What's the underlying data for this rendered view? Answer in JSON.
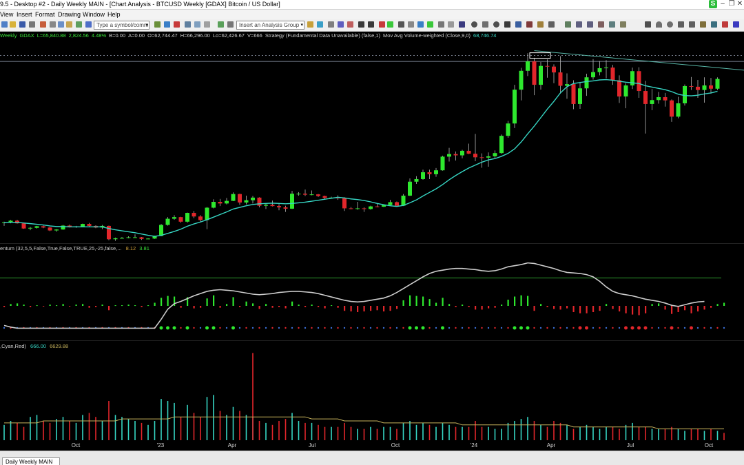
{
  "window": {
    "title": "9.5 - Desktop #2 - Daily Weekly MAIN - [Chart Analysis - BTCUSD Weekly [GDAX] Bitcoin / US Dollar]",
    "badge": "S"
  },
  "menu": [
    "View",
    "Insert",
    "Format",
    "Drawing",
    "Window",
    "Help"
  ],
  "toolbar": {
    "symbol_placeholder": "Type a symbol/command",
    "analysis_group_placeholder": "Insert an Analysis Group"
  },
  "status_line": [
    {
      "text": "Weekly",
      "color": "#39e339"
    },
    {
      "text": "GDAX",
      "color": "#39e339"
    },
    {
      "text": "L=65,840.88",
      "color": "#39e339"
    },
    {
      "text": "2,824.56",
      "color": "#39e339"
    },
    {
      "text": "4.48%",
      "color": "#39e339"
    },
    {
      "text": "B=0.00",
      "color": "#d0d0d0"
    },
    {
      "text": "A=0.00",
      "color": "#d0d0d0"
    },
    {
      "text": "O=62,744.47",
      "color": "#d0d0d0"
    },
    {
      "text": "H=66,296.00",
      "color": "#d0d0d0"
    },
    {
      "text": "Lo=62,426.67",
      "color": "#d0d0d0"
    },
    {
      "text": "V=666",
      "color": "#d0d0d0"
    },
    {
      "text": "Strategy (Fundamental Data Unavailable) (false,1)",
      "color": "#d0d0d0"
    },
    {
      "text": "Mov Avg Volume-weighted (Close,9,0)",
      "color": "#d0d0d0"
    },
    {
      "text": "68,746.74",
      "color": "#36d6c4"
    }
  ],
  "momentum_label": {
    "name": "entum (32,5,5,False,True,False,TRUE,25,-25,false,...",
    "v1": "8.12",
    "v2": "3.81"
  },
  "volume_label": {
    "name": ",Cyan,Red)",
    "v1": "666.00",
    "v2": "6629.88"
  },
  "x_axis_labels": [
    "Oct",
    "'23",
    "Apr",
    "Jul",
    "Oct",
    "'24",
    "Apr",
    "Jul",
    "Oct"
  ],
  "tabs": [
    {
      "label": "Daily Weekly MAIN"
    }
  ],
  "colors": {
    "up": "#2ee82e",
    "down": "#e2262b",
    "ma": "#36d6c4",
    "momentum_line": "#cccccc",
    "volume_ma": "#c7b35c"
  },
  "chart_data": [
    {
      "type": "candlestick",
      "symbol": "BTCUSD",
      "interval": "Weekly",
      "exchange": "GDAX",
      "ohlc": [
        [
          21500,
          21900,
          20600,
          21700
        ],
        [
          21700,
          22400,
          21400,
          22200
        ],
        [
          22200,
          22500,
          21300,
          21400
        ],
        [
          21400,
          21600,
          19700,
          19800
        ],
        [
          19800,
          20300,
          19300,
          20000
        ],
        [
          20000,
          20600,
          19800,
          20500
        ],
        [
          20500,
          20700,
          19900,
          20100
        ],
        [
          20100,
          20300,
          19000,
          19200
        ],
        [
          19200,
          19600,
          18800,
          19500
        ],
        [
          19500,
          20900,
          19400,
          20700
        ],
        [
          20700,
          21000,
          20100,
          20200
        ],
        [
          20200,
          20600,
          20000,
          20400
        ],
        [
          20400,
          21300,
          20300,
          21200
        ],
        [
          21200,
          21500,
          20400,
          20600
        ],
        [
          20600,
          20800,
          19900,
          20100
        ],
        [
          20100,
          20900,
          19600,
          20600
        ],
        [
          20600,
          20700,
          16200,
          16500
        ],
        [
          16500,
          17000,
          16000,
          16800
        ],
        [
          16800,
          17200,
          16700,
          16900
        ],
        [
          16900,
          17400,
          16800,
          17100
        ],
        [
          17100,
          18000,
          16900,
          17100
        ],
        [
          17100,
          17200,
          16300,
          16600
        ],
        [
          16600,
          16800,
          16500,
          16700
        ],
        [
          16700,
          17600,
          16600,
          17500
        ],
        [
          17500,
          21200,
          17400,
          20900
        ],
        [
          20900,
          23300,
          20700,
          22800
        ],
        [
          22800,
          23900,
          22500,
          23300
        ],
        [
          23300,
          23400,
          21600,
          21900
        ],
        [
          21900,
          24700,
          21600,
          24600
        ],
        [
          24600,
          25200,
          23000,
          23500
        ],
        [
          23500,
          23900,
          21800,
          22400
        ],
        [
          22400,
          26400,
          19600,
          26200
        ],
        [
          26200,
          28800,
          26000,
          28000
        ],
        [
          28000,
          28900,
          26700,
          27500
        ],
        [
          27500,
          29200,
          27200,
          28300
        ],
        [
          28300,
          30900,
          28200,
          30400
        ],
        [
          30400,
          30500,
          27100,
          27800
        ],
        [
          27800,
          29900,
          27200,
          28500
        ],
        [
          28500,
          29800,
          27500,
          29300
        ],
        [
          29300,
          29400,
          26300,
          26800
        ],
        [
          26800,
          27500,
          25800,
          27100
        ],
        [
          27100,
          28400,
          26600,
          26700
        ],
        [
          26700,
          27300,
          25400,
          26300
        ],
        [
          26300,
          26800,
          24900,
          25900
        ],
        [
          25900,
          31400,
          25800,
          30500
        ],
        [
          30500,
          31000,
          29900,
          30500
        ],
        [
          30500,
          31800,
          29800,
          30200
        ],
        [
          30200,
          31500,
          30000,
          30300
        ],
        [
          30300,
          30400,
          29500,
          29800
        ],
        [
          29800,
          29900,
          28900,
          29200
        ],
        [
          29200,
          29600,
          29000,
          29300
        ],
        [
          29300,
          30000,
          28600,
          29100
        ],
        [
          29100,
          29400,
          25200,
          26000
        ],
        [
          26000,
          26400,
          25700,
          25900
        ],
        [
          25900,
          28000,
          25600,
          26000
        ],
        [
          26000,
          26300,
          24900,
          25800
        ],
        [
          25800,
          26800,
          25600,
          26600
        ],
        [
          26600,
          27400,
          26300,
          26500
        ],
        [
          26500,
          27100,
          26400,
          27000
        ],
        [
          27000,
          28600,
          26900,
          27900
        ],
        [
          27900,
          28100,
          26900,
          26800
        ],
        [
          26800,
          30400,
          26700,
          29900
        ],
        [
          29900,
          35200,
          29800,
          34200
        ],
        [
          34200,
          35900,
          33500,
          35000
        ],
        [
          35000,
          37900,
          34800,
          37100
        ],
        [
          37100,
          37900,
          35000,
          36500
        ],
        [
          36500,
          38400,
          35700,
          37700
        ],
        [
          37700,
          42200,
          37600,
          41900
        ],
        [
          41900,
          44600,
          40400,
          42700
        ],
        [
          42700,
          43500,
          40700,
          42300
        ],
        [
          42300,
          44000,
          41400,
          43700
        ],
        [
          43700,
          45900,
          42700,
          42800
        ],
        [
          42800,
          48900,
          40500,
          41700
        ],
        [
          41700,
          42900,
          38500,
          41600
        ],
        [
          41600,
          43200,
          38800,
          42000
        ],
        [
          42000,
          43800,
          41500,
          43000
        ],
        [
          43000,
          48700,
          42800,
          48300
        ],
        [
          48300,
          52900,
          47700,
          52100
        ],
        [
          52100,
          64000,
          50700,
          62500
        ],
        [
          62500,
          69200,
          59200,
          68300
        ],
        [
          68300,
          73700,
          66700,
          71200
        ],
        [
          71200,
          72300,
          60800,
          64000
        ],
        [
          64000,
          71000,
          62500,
          69800
        ],
        [
          69800,
          71800,
          66200,
          69600
        ],
        [
          69600,
          70300,
          64500,
          67800
        ],
        [
          67800,
          72800,
          61300,
          63700
        ],
        [
          63700,
          67500,
          59700,
          64200
        ],
        [
          64200,
          65400,
          56500,
          58100
        ],
        [
          58100,
          64900,
          56600,
          62900
        ],
        [
          62900,
          67400,
          60600,
          66300
        ],
        [
          66300,
          71900,
          65600,
          67900
        ],
        [
          67900,
          71300,
          66900,
          69100
        ],
        [
          69100,
          71600,
          66000,
          69300
        ],
        [
          69300,
          70100,
          64000,
          65400
        ],
        [
          65400,
          66900,
          58400,
          60400
        ],
        [
          60400,
          64500,
          56800,
          63800
        ],
        [
          63800,
          69300,
          62700,
          68200
        ],
        [
          68200,
          69400,
          60000,
          62100
        ],
        [
          62100,
          65200,
          49000,
          58100
        ],
        [
          58100,
          62700,
          56200,
          59300
        ],
        [
          59300,
          61800,
          58200,
          60200
        ],
        [
          60200,
          61500,
          57300,
          59200
        ],
        [
          59200,
          59500,
          52600,
          54200
        ],
        [
          54200,
          60300,
          53700,
          58300
        ],
        [
          58300,
          64100,
          57600,
          63600
        ],
        [
          63600,
          66400,
          62400,
          63400
        ],
        [
          63400,
          65500,
          60000,
          62400
        ],
        [
          62400,
          66300,
          58500,
          63800
        ],
        [
          63800,
          66100,
          61300,
          62800
        ],
        [
          62800,
          66300,
          62400,
          65800
        ]
      ],
      "ma": [
        21600,
        21700,
        21700,
        21500,
        21300,
        21100,
        20900,
        20600,
        20400,
        20400,
        20300,
        20300,
        20300,
        20300,
        20300,
        20300,
        19800,
        19400,
        19100,
        18800,
        18500,
        18100,
        17700,
        17400,
        17700,
        18300,
        18900,
        19600,
        20500,
        21200,
        21800,
        22500,
        23300,
        24100,
        24900,
        25800,
        26300,
        26800,
        27200,
        27400,
        27500,
        27600,
        27500,
        27400,
        27500,
        27700,
        27900,
        28200,
        28500,
        28800,
        29100,
        29400,
        29200,
        28900,
        28700,
        28400,
        28000,
        27500,
        27100,
        26800,
        26600,
        26900,
        27700,
        28600,
        29800,
        30900,
        32000,
        33300,
        34800,
        36100,
        37300,
        38400,
        39300,
        40200,
        40900,
        41300,
        42000,
        42900,
        44300,
        46400,
        48900,
        51300,
        53900,
        56500,
        58900,
        61500,
        63400,
        64400,
        64700,
        65000,
        65200,
        65500,
        65600,
        65400,
        65100,
        64800,
        64600,
        64400,
        63700,
        63300,
        62900,
        62500,
        61900,
        61100,
        60700,
        60600,
        60800,
        61200,
        61500,
        62000
      ],
      "y_visible_range": [
        15500,
        78000
      ],
      "horizontal_lines": [
        73000,
        71200
      ],
      "trendline": {
        "start_index": 81,
        "start": 74500,
        "end_index": 112,
        "end": 68500
      }
    },
    {
      "type": "histogram",
      "name": "Momentum",
      "values": [
        -2,
        3,
        4,
        2,
        -2,
        1,
        -1,
        2,
        1,
        3,
        -1,
        2,
        3,
        -3,
        -2,
        2,
        -7,
        1,
        1,
        2,
        1,
        -2,
        1,
        5,
        13,
        16,
        15,
        -3,
        14,
        -4,
        -3,
        12,
        17,
        -3,
        3,
        14,
        -2,
        7,
        4,
        -5,
        3,
        -3,
        -2,
        -4,
        7,
        2,
        -2,
        2,
        -2,
        -4,
        1,
        -3,
        -8,
        -9,
        -10,
        -9,
        -8,
        -7,
        -9,
        -8,
        -5,
        9,
        17,
        16,
        15,
        11,
        5,
        13,
        3,
        -2,
        2,
        -2,
        -6,
        -6,
        -4,
        -3,
        2,
        10,
        15,
        17,
        16,
        -8,
        3,
        -2,
        -5,
        -6,
        -4,
        -10,
        -12,
        -12,
        -10,
        -8,
        3,
        -5,
        -9,
        -12,
        -14,
        -15,
        -12,
        3,
        4,
        -6,
        -13,
        -10,
        -7,
        -12,
        -9,
        -6,
        -3,
        3,
        5
      ],
      "momentum_line": [
        -35,
        -38,
        -40,
        -40,
        -40,
        -40,
        -40,
        -40,
        -40,
        -40,
        -40,
        -40,
        -40,
        -40,
        -40,
        -40,
        -40,
        -40,
        -40,
        -40,
        -40,
        -40,
        -40,
        -40,
        -24,
        -6,
        4,
        8,
        13,
        18,
        22,
        26,
        28,
        29,
        28,
        27,
        25,
        23,
        21,
        20,
        21,
        22,
        24,
        25,
        26,
        26,
        25,
        24,
        22,
        19,
        16,
        13,
        10,
        8,
        7,
        8,
        10,
        12,
        14,
        18,
        24,
        31,
        38,
        45,
        52,
        58,
        62,
        64,
        66,
        67,
        67,
        66,
        65,
        63,
        62,
        63,
        66,
        70,
        72,
        74,
        77,
        76,
        73,
        70,
        67,
        63,
        60,
        59,
        58,
        56,
        52,
        44,
        34,
        26,
        22,
        20,
        18,
        15,
        12,
        10,
        8,
        5,
        1,
        -1,
        2,
        5,
        7,
        8
      ],
      "level_line": 45
    },
    {
      "type": "volume",
      "values": [
        8,
        10,
        9,
        7,
        12,
        13,
        10,
        9,
        11,
        12,
        10,
        9,
        13,
        14,
        12,
        10,
        20,
        13,
        12,
        11,
        10,
        9,
        8,
        10,
        21,
        20,
        19,
        12,
        18,
        14,
        12,
        22,
        23,
        15,
        13,
        17,
        15,
        13,
        12,
        10,
        9,
        8,
        10,
        11,
        14,
        10,
        9,
        9,
        8,
        7,
        7,
        7,
        9,
        7,
        6,
        6,
        7,
        6,
        7,
        7,
        6,
        9,
        10,
        8,
        9,
        8,
        7,
        9,
        8,
        7,
        7,
        7,
        10,
        7,
        7,
        6,
        6,
        9,
        10,
        11,
        12,
        10,
        8,
        7,
        10,
        9,
        8,
        6,
        7,
        8,
        7,
        6,
        7,
        7,
        6,
        8,
        9,
        7,
        7,
        6,
        6,
        6,
        7,
        6,
        5,
        6,
        6,
        5,
        6,
        5,
        4
      ],
      "spike": {
        "index": 38,
        "value": 44
      },
      "volume_ma": [
        9,
        9,
        9,
        9,
        9,
        9,
        10,
        10,
        10,
        10,
        10,
        10,
        10,
        10,
        10,
        10,
        10,
        10,
        11,
        11,
        11,
        11,
        11,
        11,
        11,
        11,
        12,
        12,
        12,
        12,
        12,
        12,
        12,
        12,
        12,
        12,
        12,
        12,
        12,
        12,
        12,
        12,
        12,
        12,
        12,
        12,
        12,
        11,
        11,
        11,
        11,
        11,
        10,
        10,
        10,
        10,
        10,
        10,
        9,
        9,
        9,
        9,
        9,
        9,
        9,
        9,
        9,
        9,
        9,
        9,
        8,
        8,
        8,
        8,
        8,
        8,
        8,
        8,
        8,
        8,
        8,
        8,
        8,
        8,
        8,
        8,
        8,
        7,
        7,
        7,
        7,
        7,
        7,
        7,
        7,
        7,
        7,
        7,
        7,
        7,
        6,
        6,
        6,
        6,
        6,
        6,
        6,
        6,
        6,
        6,
        6
      ]
    }
  ]
}
